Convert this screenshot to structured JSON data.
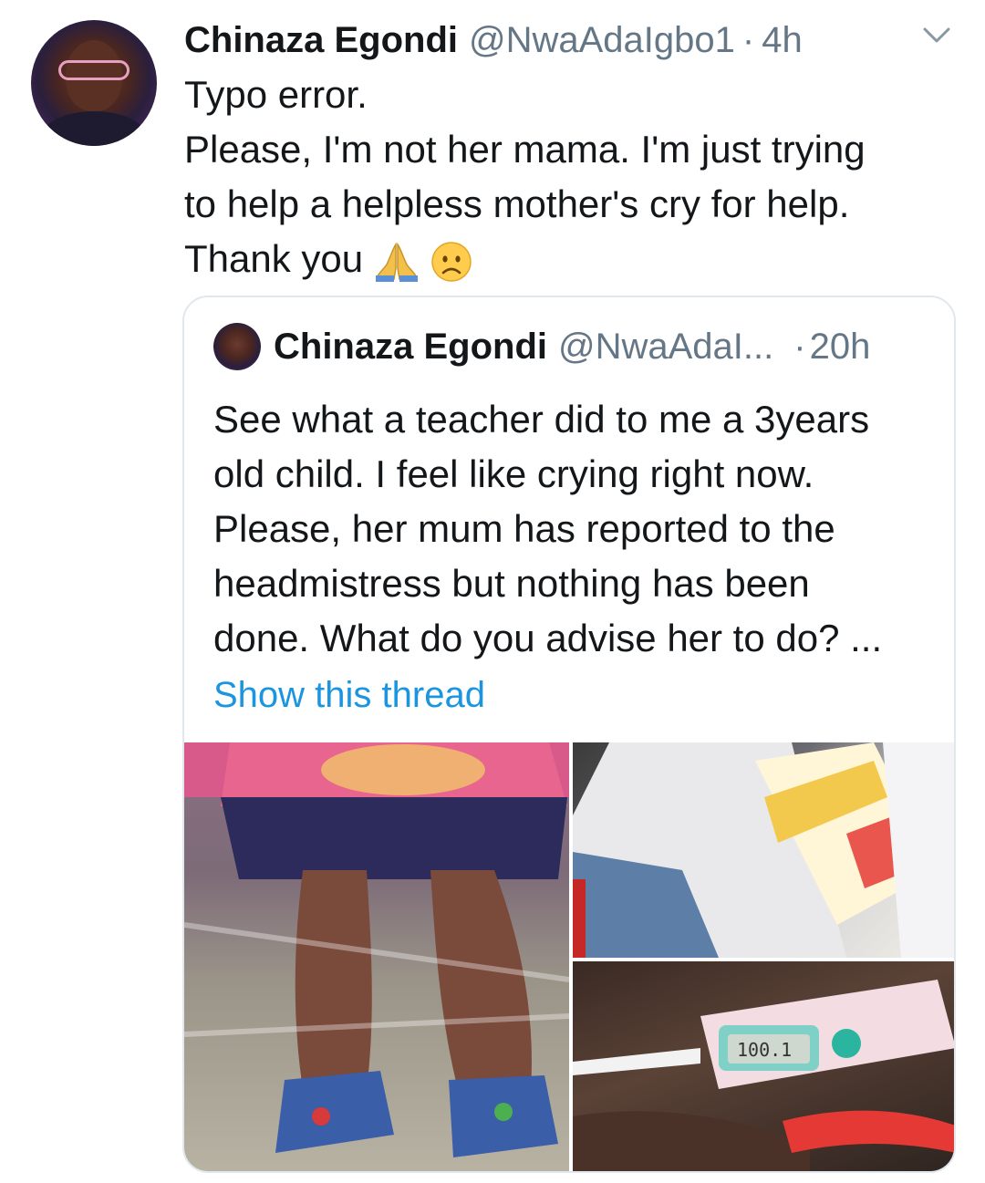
{
  "tweet": {
    "author_name": "Chinaza Egondi",
    "author_handle": "@NwaAdaIgbo1",
    "separator": "·",
    "time": "4h",
    "text_lines": [
      "Typo error.",
      "Please, I'm not her mama. I'm just trying",
      "to help a helpless mother's cry for help.",
      "Thank you"
    ],
    "emojis": [
      "folded-hands-icon",
      "frowning-face-icon"
    ]
  },
  "quoted_tweet": {
    "author_name": "Chinaza Egondi",
    "author_handle": "@NwaAdaI...",
    "separator": "·",
    "time": "20h",
    "text_lines": [
      "See what a teacher did to me a 3years",
      "old child. I feel like crying right now.",
      "Please, her mum has reported to the",
      "headmistress but nothing has been",
      "done. What do you advise her to do? ..."
    ],
    "show_thread_label": "Show this thread",
    "photos": [
      {
        "name": "photo-child-legs"
      },
      {
        "name": "photo-bag-with-mi-cee"
      },
      {
        "name": "photo-thermometer",
        "reading": "100.1"
      }
    ]
  },
  "colors": {
    "text": "#14171a",
    "secondary": "#657786",
    "link": "#1b95e0",
    "border": "#e1e8ed"
  }
}
